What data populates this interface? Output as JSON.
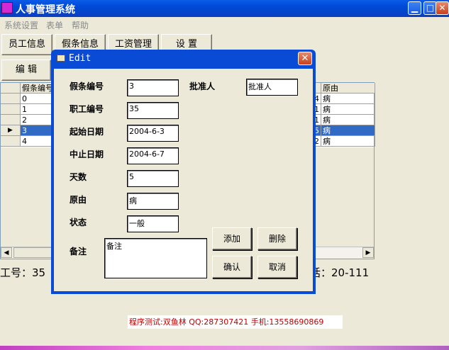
{
  "window": {
    "title": "人事管理系统"
  },
  "menu": [
    "系统设置",
    "表单",
    "帮助"
  ],
  "toolbar": {
    "tabs": [
      "员工信息",
      "假条信息",
      "工资管理",
      "设  置"
    ],
    "edit_label": "编  辑"
  },
  "grid": {
    "header_left": "假条编号",
    "header_right": "原由",
    "rows": [
      {
        "id": "0",
        "prefix": "4",
        "reason": "病"
      },
      {
        "id": "1",
        "prefix": "1",
        "reason": "病"
      },
      {
        "id": "2",
        "prefix": "1",
        "reason": "病"
      },
      {
        "id": "3",
        "prefix": "5",
        "reason": "病",
        "selected": true
      },
      {
        "id": "4",
        "prefix": "2",
        "reason": "病"
      }
    ]
  },
  "status": {
    "left": "工号：35",
    "right": "话：20-111"
  },
  "footer": "程序测试:双鱼林 QQ:287307421 手机:13558690869",
  "dialog": {
    "title": "Edit",
    "fields": {
      "leave_id_label": "假条编号",
      "leave_id": "3",
      "employee_id_label": "职工编号",
      "employee_id": "35",
      "start_date_label": "起始日期",
      "start_date": "2004-6-3",
      "end_date_label": "中止日期",
      "end_date": "2004-6-7",
      "days_label": "天数",
      "days": "5",
      "reason_label": "原由",
      "reason": "病",
      "status_label": "状态",
      "status": "一般",
      "approver_label": "批准人",
      "approver": "批准人",
      "note_label": "备注",
      "note": "备注"
    },
    "buttons": {
      "add": "添加",
      "delete": "删除",
      "confirm": "确认",
      "cancel": "取消"
    }
  }
}
